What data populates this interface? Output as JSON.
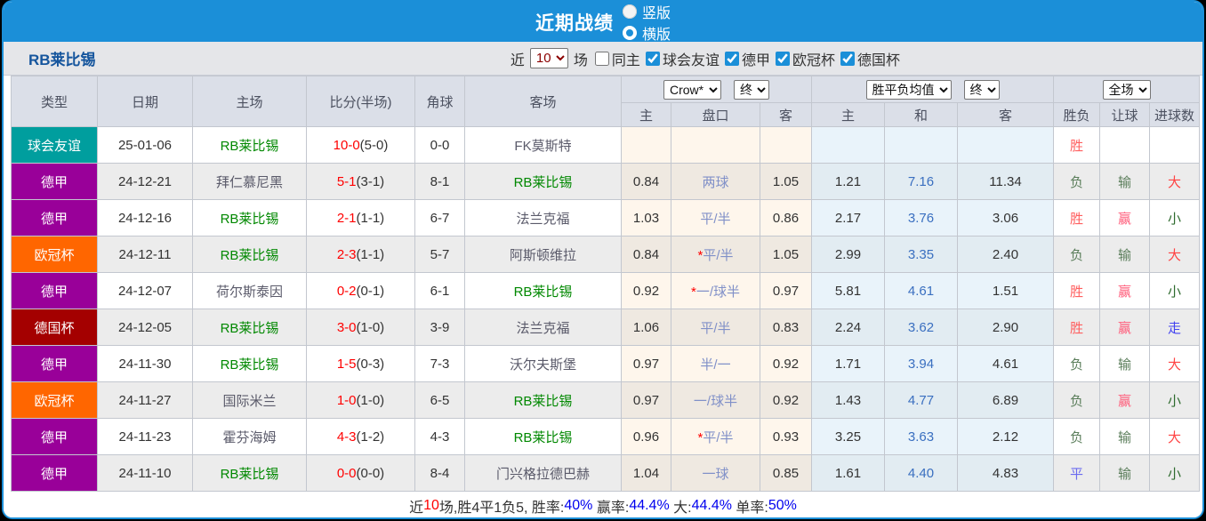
{
  "colors": {
    "topbar": "#1b8fd8",
    "type_badges": {
      "球会友谊": "#009e9e",
      "德甲": "#990099",
      "欧冠杯": "#ff6600",
      "德国杯": "#a40000"
    },
    "team_highlight": "#008800",
    "score_red": "#ff0000",
    "handicap_blue": "#8090c8",
    "avg_blue": "#3a6fc0",
    "result": {
      "胜": "#ff5f5f",
      "负": "#5b7e5b",
      "平": "#6a6af0",
      "赢": "#ff5c7a",
      "输": "#5b7e5b",
      "大": "#ff4343",
      "小": "#2f6b2f",
      "走": "#4343f0"
    }
  },
  "topbar": {
    "title": "近期战绩",
    "radios": [
      {
        "label": "竖版",
        "checked": false
      },
      {
        "label": "横版",
        "checked": true
      }
    ]
  },
  "filterbar": {
    "team": "RB莱比锡",
    "near_label": "近",
    "near_value": "10",
    "near_suffix": "场",
    "checkboxes": [
      {
        "label": "同主",
        "checked": false
      },
      {
        "label": "球会友谊",
        "checked": true
      },
      {
        "label": "德甲",
        "checked": true
      },
      {
        "label": "欧冠杯",
        "checked": true
      },
      {
        "label": "德国杯",
        "checked": true
      }
    ]
  },
  "table": {
    "left_headers": [
      "类型",
      "日期",
      "主场",
      "比分(半场)",
      "角球",
      "客场"
    ],
    "group_selects": {
      "odds_provider": "Crow*",
      "odds_time": "终",
      "avg_type": "胜平负均值",
      "avg_time": "终",
      "range": "全场"
    },
    "sub_headers": [
      "主",
      "盘口",
      "客",
      "主",
      "和",
      "客",
      "胜负",
      "让球",
      "进球数"
    ],
    "rows": [
      {
        "league": "球会友谊",
        "date": "25-01-06",
        "home": "RB莱比锡",
        "score": "10-0",
        "half": "(5-0)",
        "corner": "0-0",
        "away": "FK莫斯特",
        "odds": [
          "",
          "",
          ""
        ],
        "avg": [
          "",
          "",
          ""
        ],
        "wl": "胜",
        "handicap_result": "",
        "goals": ""
      },
      {
        "league": "德甲",
        "date": "24-12-21",
        "home": "拜仁慕尼黑",
        "score": "5-1",
        "half": "(3-1)",
        "corner": "8-1",
        "away": "RB莱比锡",
        "odds": [
          "0.84",
          "两球",
          "1.05"
        ],
        "avg": [
          "1.21",
          "7.16",
          "11.34"
        ],
        "wl": "负",
        "handicap_result": "输",
        "goals": "大"
      },
      {
        "league": "德甲",
        "date": "24-12-16",
        "home": "RB莱比锡",
        "score": "2-1",
        "half": "(1-1)",
        "corner": "6-7",
        "away": "法兰克福",
        "odds": [
          "1.03",
          "平/半",
          "0.86"
        ],
        "avg": [
          "2.17",
          "3.76",
          "3.06"
        ],
        "wl": "胜",
        "handicap_result": "赢",
        "goals": "小"
      },
      {
        "league": "欧冠杯",
        "date": "24-12-11",
        "home": "RB莱比锡",
        "score": "2-3",
        "half": "(1-1)",
        "corner": "5-7",
        "away": "阿斯顿维拉",
        "odds": [
          "0.84",
          "*平/半",
          "1.05"
        ],
        "avg": [
          "2.99",
          "3.35",
          "2.40"
        ],
        "wl": "负",
        "handicap_result": "输",
        "goals": "大"
      },
      {
        "league": "德甲",
        "date": "24-12-07",
        "home": "荷尔斯泰因",
        "score": "0-2",
        "half": "(0-1)",
        "corner": "6-1",
        "away": "RB莱比锡",
        "odds": [
          "0.92",
          "*一/球半",
          "0.97"
        ],
        "avg": [
          "5.81",
          "4.61",
          "1.51"
        ],
        "wl": "胜",
        "handicap_result": "赢",
        "goals": "小"
      },
      {
        "league": "德国杯",
        "date": "24-12-05",
        "home": "RB莱比锡",
        "score": "3-0",
        "half": "(1-0)",
        "corner": "3-9",
        "away": "法兰克福",
        "odds": [
          "1.06",
          "平/半",
          "0.83"
        ],
        "avg": [
          "2.24",
          "3.62",
          "2.90"
        ],
        "wl": "胜",
        "handicap_result": "赢",
        "goals": "走"
      },
      {
        "league": "德甲",
        "date": "24-11-30",
        "home": "RB莱比锡",
        "score": "1-5",
        "half": "(0-3)",
        "corner": "7-3",
        "away": "沃尔夫斯堡",
        "odds": [
          "0.97",
          "半/一",
          "0.92"
        ],
        "avg": [
          "1.71",
          "3.94",
          "4.61"
        ],
        "wl": "负",
        "handicap_result": "输",
        "goals": "大"
      },
      {
        "league": "欧冠杯",
        "date": "24-11-27",
        "home": "国际米兰",
        "score": "1-0",
        "half": "(1-0)",
        "corner": "6-5",
        "away": "RB莱比锡",
        "odds": [
          "0.97",
          "一/球半",
          "0.92"
        ],
        "avg": [
          "1.43",
          "4.77",
          "6.89"
        ],
        "wl": "负",
        "handicap_result": "赢",
        "goals": "小"
      },
      {
        "league": "德甲",
        "date": "24-11-23",
        "home": "霍芬海姆",
        "score": "4-3",
        "half": "(1-2)",
        "corner": "4-3",
        "away": "RB莱比锡",
        "odds": [
          "0.96",
          "*平/半",
          "0.93"
        ],
        "avg": [
          "3.25",
          "3.63",
          "2.12"
        ],
        "wl": "负",
        "handicap_result": "输",
        "goals": "大"
      },
      {
        "league": "德甲",
        "date": "24-11-10",
        "home": "RB莱比锡",
        "score": "0-0",
        "half": "(0-0)",
        "corner": "8-4",
        "away": "门兴格拉德巴赫",
        "odds": [
          "1.04",
          "一球",
          "0.85"
        ],
        "avg": [
          "1.61",
          "4.40",
          "4.83"
        ],
        "wl": "平",
        "handicap_result": "输",
        "goals": "小"
      }
    ]
  },
  "footer": {
    "segments": [
      {
        "text": "近",
        "color": "#333333"
      },
      {
        "text": "10",
        "color": "#ff0000"
      },
      {
        "text": "场,胜4平1负5, 胜率:",
        "color": "#333333"
      },
      {
        "text": "40%",
        "color": "#0000ee"
      },
      {
        "text": " 赢率:",
        "color": "#333333"
      },
      {
        "text": "44.4%",
        "color": "#0000ee"
      },
      {
        "text": " 大:",
        "color": "#333333"
      },
      {
        "text": "44.4%",
        "color": "#0000ee"
      },
      {
        "text": " 单率:",
        "color": "#333333"
      },
      {
        "text": "50%",
        "color": "#0000ee"
      }
    ]
  }
}
